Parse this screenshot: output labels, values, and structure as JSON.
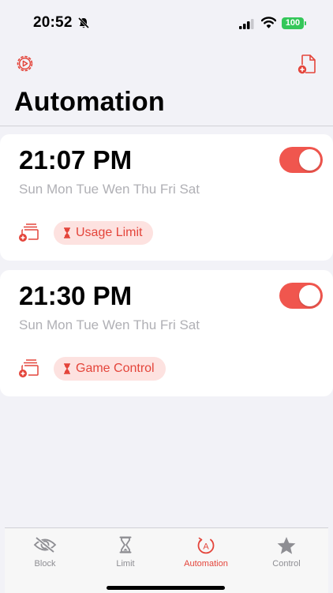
{
  "status_bar": {
    "time": "20:52",
    "battery": "100"
  },
  "header": {
    "title": "Automation"
  },
  "automations": [
    {
      "time": "21:07 PM",
      "days": "Sun Mon Tue Wen Thu Fri Sat",
      "enabled": true,
      "tag": "Usage Limit"
    },
    {
      "time": "21:30 PM",
      "days": "Sun Mon Tue Wen Thu Fri Sat",
      "enabled": true,
      "tag": "Game Control"
    }
  ],
  "tab_bar": {
    "items": [
      {
        "label": "Block",
        "icon": "eye-slash-icon"
      },
      {
        "label": "Limit",
        "icon": "hourglass-icon"
      },
      {
        "label": "Automation",
        "icon": "automation-icon",
        "active": true
      },
      {
        "label": "Control",
        "icon": "star-icon"
      }
    ]
  },
  "colors": {
    "accent": "#e4453b",
    "toggle_on": "#f0564e",
    "chip_bg": "#fde2e0",
    "battery": "#34c759"
  }
}
